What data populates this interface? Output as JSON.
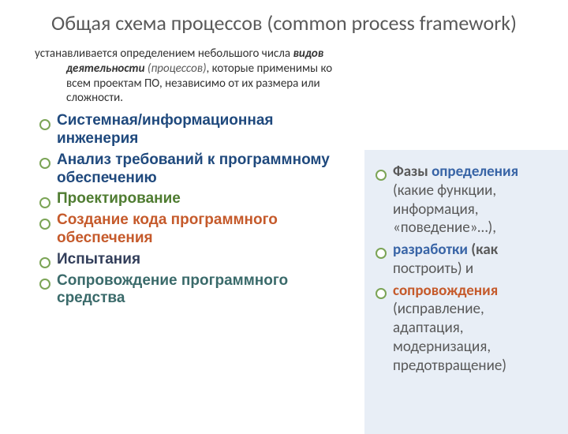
{
  "title": "Общая схема процессов (common process framework)",
  "intro_pre": "устанавливается определением небольшого числа ",
  "intro_em": "видов деятельности ",
  "intro_em2": "(процессов)",
  "intro_post": ", которые применимы ко всем проектам ПО, независимо от их размера или сложности.",
  "left": {
    "items": [
      "Системная/информационная инженерия",
      "Анализ требований к программному обеспечению",
      "Проектирование",
      "Создание кода программного обеспечения",
      "Испытания",
      "Сопровождение программного средства"
    ]
  },
  "right": {
    "l1_w1": "Фазы",
    "l1_w2": "определения",
    "l1_rest": "(какие функции, информация, «поведение»…),",
    "l2_w1": "разработки",
    "l2_rest1": "(как",
    "l2_rest2": "построить)",
    "l2_tail": " и",
    "l3_w1": "сопровождения",
    "l3_rest": "(исправление, адаптация, модернизация, предотвращение)"
  }
}
